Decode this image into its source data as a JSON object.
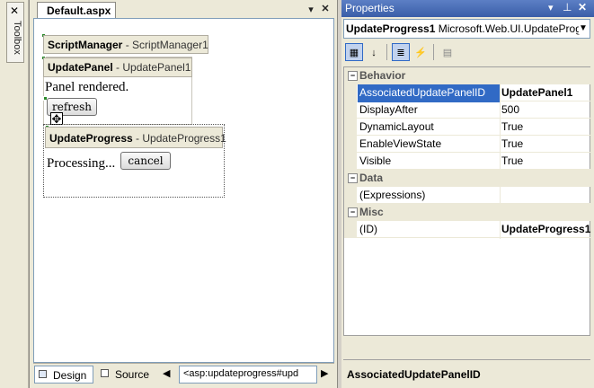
{
  "toolbox": {
    "label": "Toolbox"
  },
  "designer": {
    "tab_title": "Default.aspx",
    "scriptmanager": {
      "type": "ScriptManager",
      "id": "- ScriptManager1"
    },
    "updatepanel": {
      "type": "UpdatePanel",
      "id": "- UpdatePanel1",
      "text": "Panel rendered.",
      "button": "refresh"
    },
    "updateprogress": {
      "type": "UpdateProgress",
      "id": "- UpdateProgress1",
      "text": "Processing...",
      "button": "cancel"
    },
    "views": {
      "design": "Design",
      "source": "Source"
    },
    "tag_path": "<asp:updateprogress#upd"
  },
  "properties": {
    "title": "Properties",
    "selected_object": "UpdateProgress1",
    "selected_type": "Microsoft.Web.UI.UpdateProg",
    "categories": [
      {
        "name": "Behavior",
        "rows": [
          {
            "name": "AssociatedUpdatePanelID",
            "value": "UpdatePanel1"
          },
          {
            "name": "DisplayAfter",
            "value": "500"
          },
          {
            "name": "DynamicLayout",
            "value": "True"
          },
          {
            "name": "EnableViewState",
            "value": "True"
          },
          {
            "name": "Visible",
            "value": "True"
          }
        ]
      },
      {
        "name": "Data",
        "rows": [
          {
            "name": "(Expressions)",
            "value": ""
          }
        ]
      },
      {
        "name": "Misc",
        "rows": [
          {
            "name": "(ID)",
            "value": "UpdateProgress1"
          }
        ]
      }
    ],
    "description": "AssociatedUpdatePanelID"
  }
}
